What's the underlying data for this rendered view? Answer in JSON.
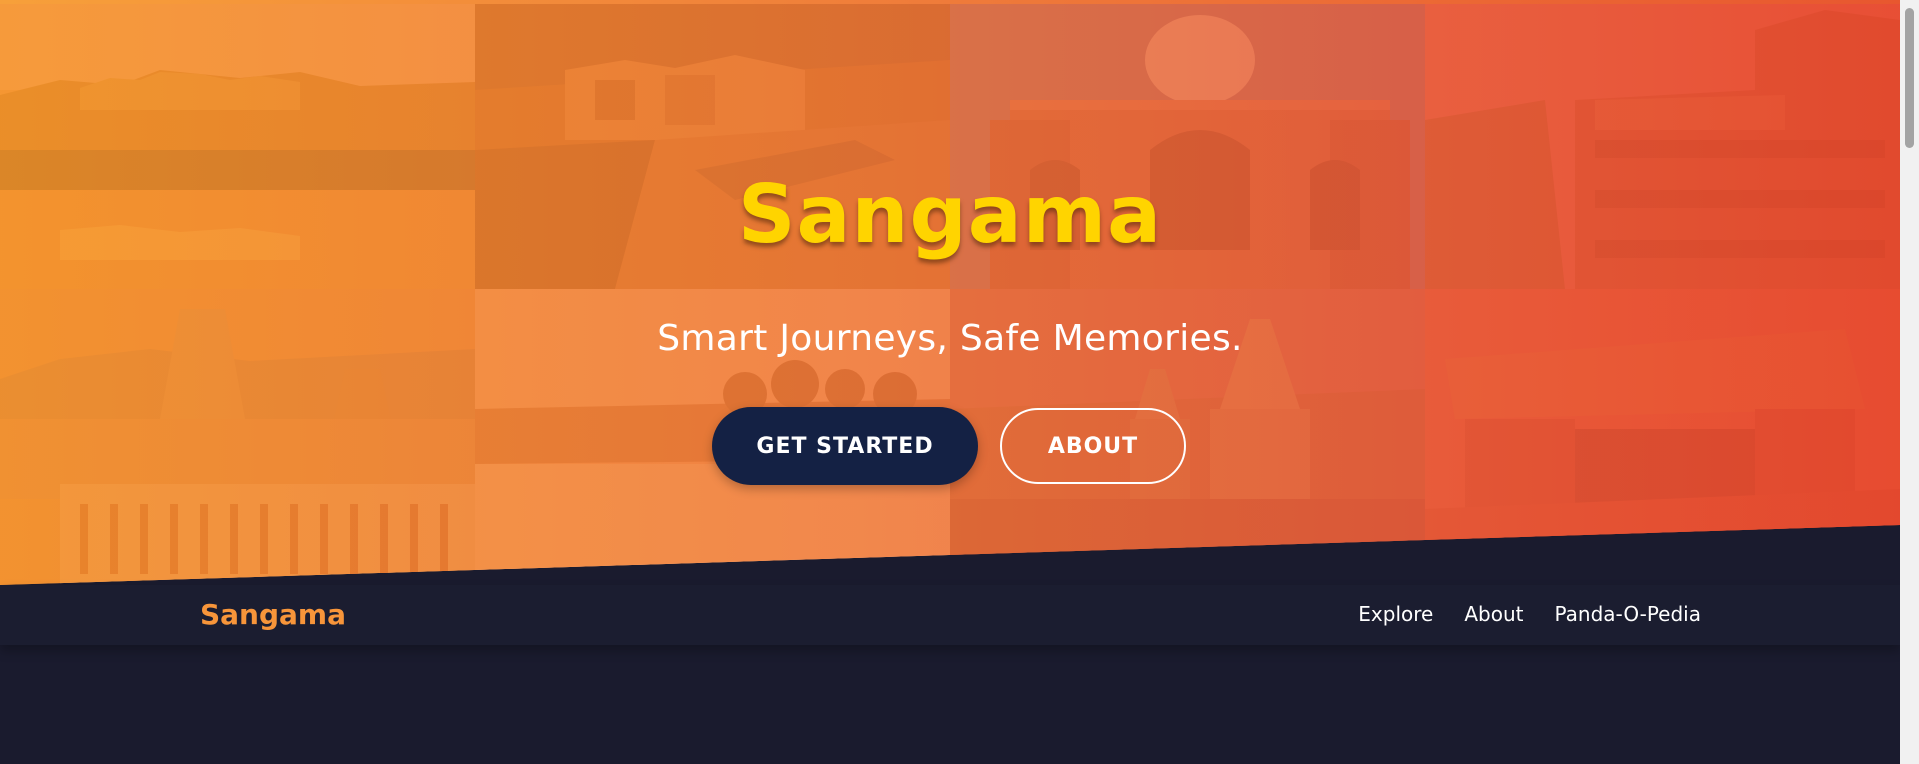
{
  "hero": {
    "title": "Sangama",
    "subtitle": "Smart Journeys, Safe Memories.",
    "primary_button": "GET STARTED",
    "secondary_button": "ABOUT"
  },
  "navbar": {
    "brand": "Sangama",
    "links": [
      {
        "label": "Explore"
      },
      {
        "label": "About"
      },
      {
        "label": "Panda-O-Pedia"
      }
    ]
  },
  "colors": {
    "accent_orange": "#f7953a",
    "title_yellow": "#ffd400",
    "navy_button": "#142144",
    "page_background": "#1a1b2e"
  },
  "hero_images": [
    "lake-palace-photo",
    "rock-cave-ruins-photo",
    "mughal-tomb-photo",
    "carved-temple-wall-photo",
    "gopuram-temple-photo",
    "palm-beach-photo",
    "hill-temple-photo",
    "rock-arch-photo"
  ]
}
